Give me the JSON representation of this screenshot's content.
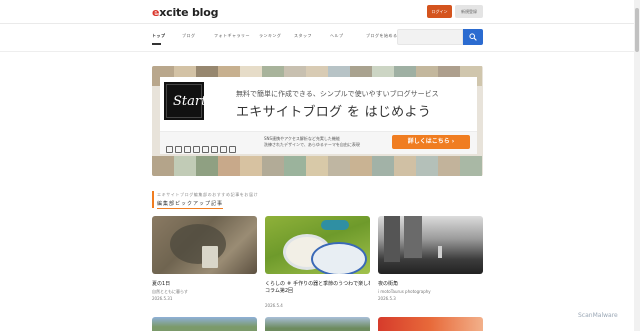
{
  "header": {
    "logo": "excite blog",
    "login_label": "ログイン",
    "signup_label": "新規登録"
  },
  "nav": {
    "items": [
      "トップ",
      "ブログ",
      "フォトギャラリー",
      "ランキング",
      "スタッフ",
      "ヘルプ",
      "ブログを始める"
    ]
  },
  "search": {
    "placeholder": ""
  },
  "hero": {
    "logo_text": "Start",
    "subtitle": "無料で簡単に作成できる、シンプルで使いやすいブログサービス",
    "title": "エキサイトブログ を はじめよう",
    "feature1": "SNS連携やアクセス解析など充実した機能",
    "feature2": "洗練されたデザインで、あらゆるテーマを自由に表現",
    "cta_label": "詳しくはこちら ›"
  },
  "section": {
    "subtitle": "エキサイトブログ編集部のおすすめ記事をお届け",
    "title": "編集部ピックアップ記事"
  },
  "cards": [
    {
      "title": "夏の1日",
      "title_line2": "",
      "author": "自然とともに暮らす",
      "date": "2026.5.31"
    },
    {
      "title": "くらしの ＃ 手作りの器と季節のうつわで楽しむ食卓のひととき",
      "title_line2": "コラム第2回",
      "author": "",
      "date": "2026.5.4"
    },
    {
      "title": "夜の街角",
      "title_line2": "",
      "author": "i motoTaurus photography",
      "date": "2026.5.3"
    }
  ],
  "watermark": "ScanMalware",
  "colors": {
    "accent": "#f07d21",
    "login": "#d4541e",
    "search": "#2b6bd0",
    "logo_red": "#d9352b"
  },
  "icons": [
    "search-icon",
    "phone-icon",
    "chart-icon",
    "image-icon",
    "lock-icon",
    "comment-icon",
    "mobile-icon",
    "heart-icon",
    "mail-icon"
  ]
}
